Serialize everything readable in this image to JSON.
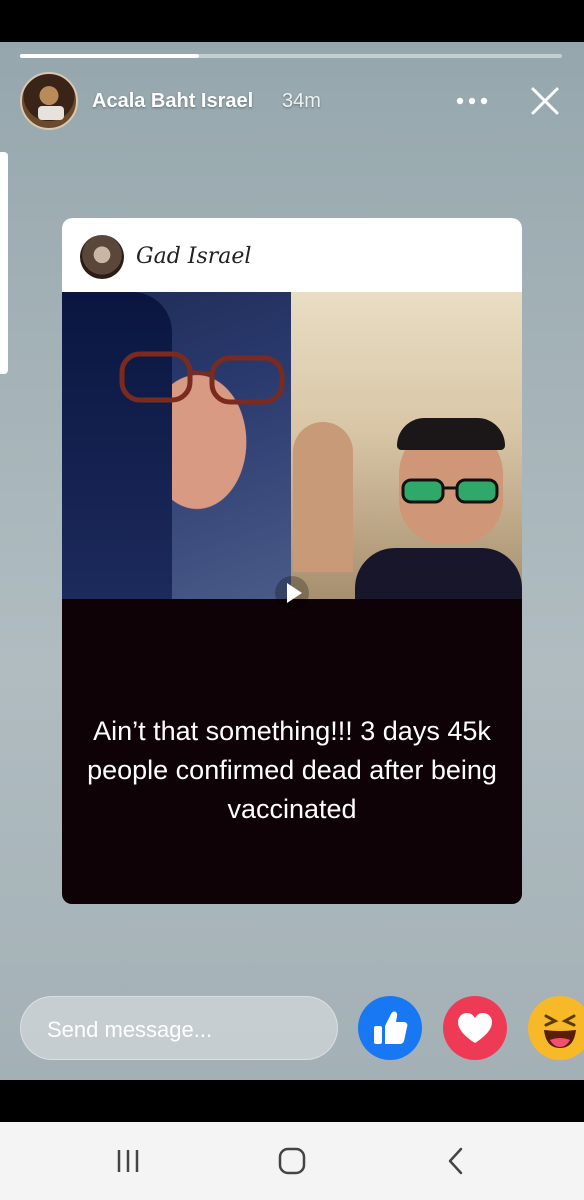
{
  "story": {
    "progress": 0.33,
    "user_name": "Acala Baht Israel",
    "time_ago": "34m"
  },
  "shared_post": {
    "author": "Gad Israel",
    "caption": "Ain’t that something!!! 3 days 45k people confirmed dead after being vaccinated"
  },
  "reply_bar": {
    "placeholder": "Send message..."
  },
  "icons": {
    "more": "more-horizontal-icon",
    "close": "close-icon",
    "play": "play-icon",
    "like": "thumbs-up-icon",
    "love": "heart-icon",
    "haha": "laughing-emoji-icon",
    "nav_recents": "recents-icon",
    "nav_home": "home-icon",
    "nav_back": "back-icon"
  },
  "colors": {
    "like": "#1877f2",
    "love": "#ef3a55",
    "haha": "#f7b928"
  }
}
